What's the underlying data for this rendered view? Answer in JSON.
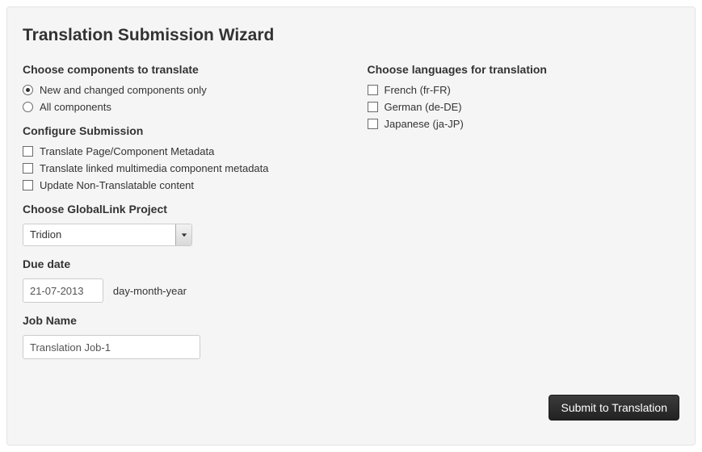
{
  "title": "Translation Submission Wizard",
  "components": {
    "heading": "Choose components to translate",
    "options": [
      {
        "label": "New and changed components only",
        "selected": true
      },
      {
        "label": "All components",
        "selected": false
      }
    ]
  },
  "configure": {
    "heading": "Configure Submission",
    "options": [
      {
        "label": "Translate Page/Component Metadata",
        "checked": false
      },
      {
        "label": "Translate linked multimedia component metadata",
        "checked": false
      },
      {
        "label": "Update Non-Translatable content",
        "checked": false
      }
    ]
  },
  "project": {
    "heading": "Choose GlobalLink Project",
    "value": "Tridion"
  },
  "due_date": {
    "heading": "Due date",
    "value": "21-07-2013",
    "hint": "day-month-year"
  },
  "job_name": {
    "heading": "Job Name",
    "value": "Translation Job-1"
  },
  "languages": {
    "heading": "Choose languages for translation",
    "options": [
      {
        "label": "French (fr-FR)",
        "checked": false
      },
      {
        "label": "German (de-DE)",
        "checked": false
      },
      {
        "label": "Japanese (ja-JP)",
        "checked": false
      }
    ]
  },
  "submit_label": "Submit to Translation"
}
